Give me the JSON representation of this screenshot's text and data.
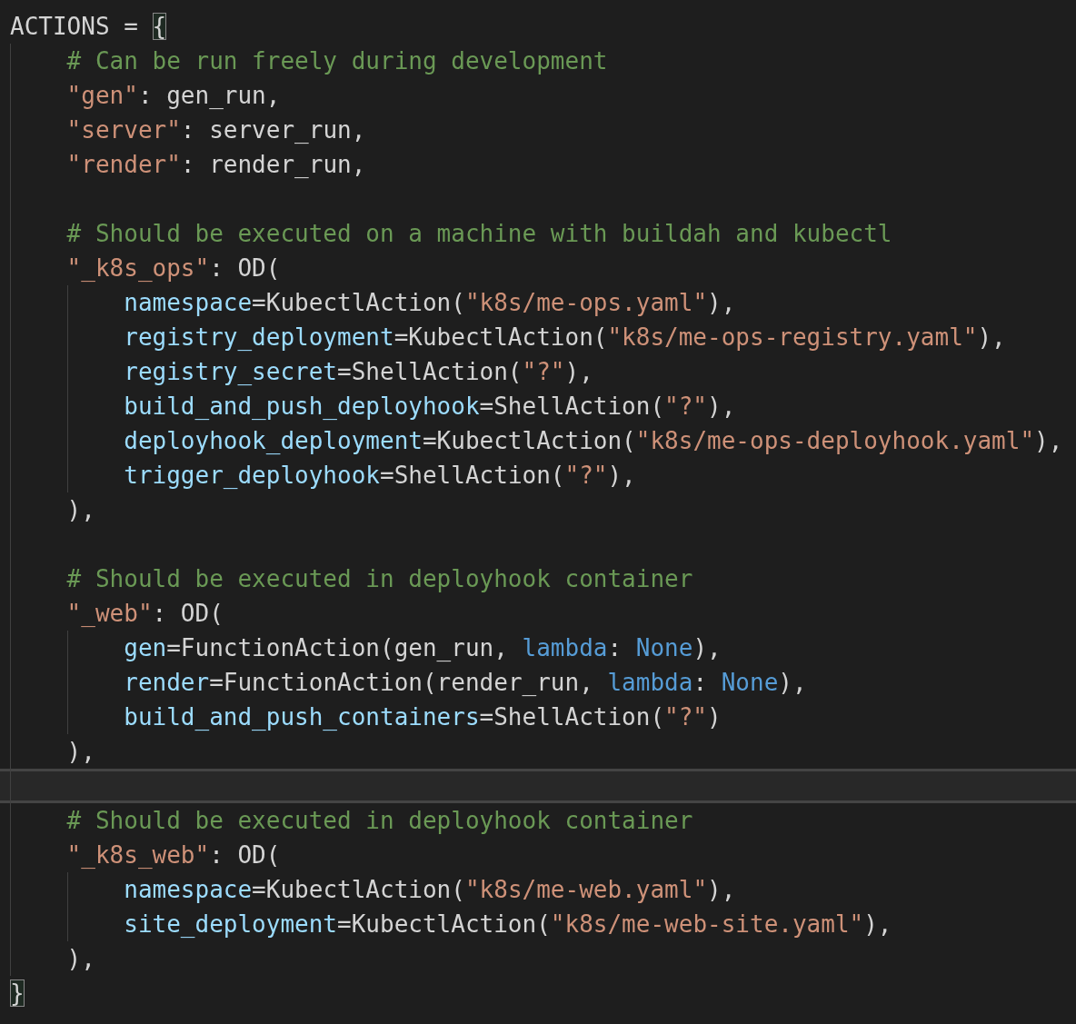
{
  "lines": [
    {
      "current": false,
      "tokens": [
        {
          "kind": "plain",
          "text": "ACTIONS = "
        },
        {
          "kind": "bracket",
          "text": "{"
        }
      ]
    },
    {
      "current": false,
      "tokens": [
        {
          "kind": "comment",
          "text": "    # Can be run freely during development"
        }
      ]
    },
    {
      "current": false,
      "tokens": [
        {
          "kind": "string",
          "text": "    \"gen\""
        },
        {
          "kind": "plain",
          "text": ": gen_run,"
        }
      ]
    },
    {
      "current": false,
      "tokens": [
        {
          "kind": "string",
          "text": "    \"server\""
        },
        {
          "kind": "plain",
          "text": ": server_run,"
        }
      ]
    },
    {
      "current": false,
      "tokens": [
        {
          "kind": "string",
          "text": "    \"render\""
        },
        {
          "kind": "plain",
          "text": ": render_run,"
        }
      ]
    },
    {
      "current": false
    },
    {
      "current": false,
      "tokens": [
        {
          "kind": "comment",
          "text": "    # Should be executed on a machine with buildah and kubectl"
        }
      ]
    },
    {
      "current": false,
      "tokens": [
        {
          "kind": "string",
          "text": "    \"_k8s_ops\""
        },
        {
          "kind": "plain",
          "text": ": OD("
        }
      ]
    },
    {
      "current": false,
      "tokens": [
        {
          "kind": "param",
          "text": "        namespace"
        },
        {
          "kind": "plain",
          "text": "=KubectlAction("
        },
        {
          "kind": "string",
          "text": "\"k8s/me-ops.yaml\""
        },
        {
          "kind": "plain",
          "text": "),"
        }
      ]
    },
    {
      "current": false,
      "tokens": [
        {
          "kind": "param",
          "text": "        registry_deployment"
        },
        {
          "kind": "plain",
          "text": "=KubectlAction("
        },
        {
          "kind": "string",
          "text": "\"k8s/me-ops-registry.yaml\""
        },
        {
          "kind": "plain",
          "text": "),"
        }
      ]
    },
    {
      "current": false,
      "tokens": [
        {
          "kind": "param",
          "text": "        registry_secret"
        },
        {
          "kind": "plain",
          "text": "=ShellAction("
        },
        {
          "kind": "string",
          "text": "\"?\""
        },
        {
          "kind": "plain",
          "text": "),"
        }
      ]
    },
    {
      "current": false,
      "tokens": [
        {
          "kind": "param",
          "text": "        build_and_push_deployhook"
        },
        {
          "kind": "plain",
          "text": "=ShellAction("
        },
        {
          "kind": "string",
          "text": "\"?\""
        },
        {
          "kind": "plain",
          "text": "),"
        }
      ]
    },
    {
      "current": false,
      "tokens": [
        {
          "kind": "param",
          "text": "        deployhook_deployment"
        },
        {
          "kind": "plain",
          "text": "=KubectlAction("
        },
        {
          "kind": "string",
          "text": "\"k8s/me-ops-deployhook.yaml\""
        },
        {
          "kind": "plain",
          "text": "),"
        }
      ]
    },
    {
      "current": false,
      "tokens": [
        {
          "kind": "param",
          "text": "        trigger_deployhook"
        },
        {
          "kind": "plain",
          "text": "=ShellAction("
        },
        {
          "kind": "string",
          "text": "\"?\""
        },
        {
          "kind": "plain",
          "text": "),"
        }
      ]
    },
    {
      "current": false,
      "tokens": [
        {
          "kind": "plain",
          "text": "    ),"
        }
      ]
    },
    {
      "current": false
    },
    {
      "current": false,
      "tokens": [
        {
          "kind": "comment",
          "text": "    # Should be executed in deployhook container"
        }
      ]
    },
    {
      "current": false,
      "tokens": [
        {
          "kind": "string",
          "text": "    \"_web\""
        },
        {
          "kind": "plain",
          "text": ": OD("
        }
      ]
    },
    {
      "current": false,
      "tokens": [
        {
          "kind": "param",
          "text": "        gen"
        },
        {
          "kind": "plain",
          "text": "=FunctionAction(gen_run, "
        },
        {
          "kind": "keyword",
          "text": "lambda"
        },
        {
          "kind": "plain",
          "text": ": "
        },
        {
          "kind": "keyword",
          "text": "None"
        },
        {
          "kind": "plain",
          "text": "),"
        }
      ]
    },
    {
      "current": false,
      "tokens": [
        {
          "kind": "param",
          "text": "        render"
        },
        {
          "kind": "plain",
          "text": "=FunctionAction(render_run, "
        },
        {
          "kind": "keyword",
          "text": "lambda"
        },
        {
          "kind": "plain",
          "text": ": "
        },
        {
          "kind": "keyword",
          "text": "None"
        },
        {
          "kind": "plain",
          "text": "),"
        }
      ]
    },
    {
      "current": false,
      "tokens": [
        {
          "kind": "param",
          "text": "        build_and_push_containers"
        },
        {
          "kind": "plain",
          "text": "=ShellAction("
        },
        {
          "kind": "string",
          "text": "\"?\""
        },
        {
          "kind": "plain",
          "text": ")"
        }
      ]
    },
    {
      "current": false,
      "tokens": [
        {
          "kind": "plain",
          "text": "    ),"
        }
      ]
    },
    {
      "current": true
    },
    {
      "current": false,
      "tokens": [
        {
          "kind": "comment",
          "text": "    # Should be executed in deployhook container"
        }
      ]
    },
    {
      "current": false,
      "tokens": [
        {
          "kind": "string",
          "text": "    \"_k8s_web\""
        },
        {
          "kind": "plain",
          "text": ": OD("
        }
      ]
    },
    {
      "current": false,
      "tokens": [
        {
          "kind": "param",
          "text": "        namespace"
        },
        {
          "kind": "plain",
          "text": "=KubectlAction("
        },
        {
          "kind": "string",
          "text": "\"k8s/me-web.yaml\""
        },
        {
          "kind": "plain",
          "text": "),"
        }
      ]
    },
    {
      "current": false,
      "tokens": [
        {
          "kind": "param",
          "text": "        site_deployment"
        },
        {
          "kind": "plain",
          "text": "=KubectlAction("
        },
        {
          "kind": "string",
          "text": "\"k8s/me-web-site.yaml\""
        },
        {
          "kind": "plain",
          "text": "),"
        }
      ]
    },
    {
      "current": false,
      "tokens": [
        {
          "kind": "plain",
          "text": "    ),"
        }
      ]
    },
    {
      "current": false,
      "tokens": [
        {
          "kind": "bracket",
          "text": "}"
        }
      ]
    }
  ]
}
